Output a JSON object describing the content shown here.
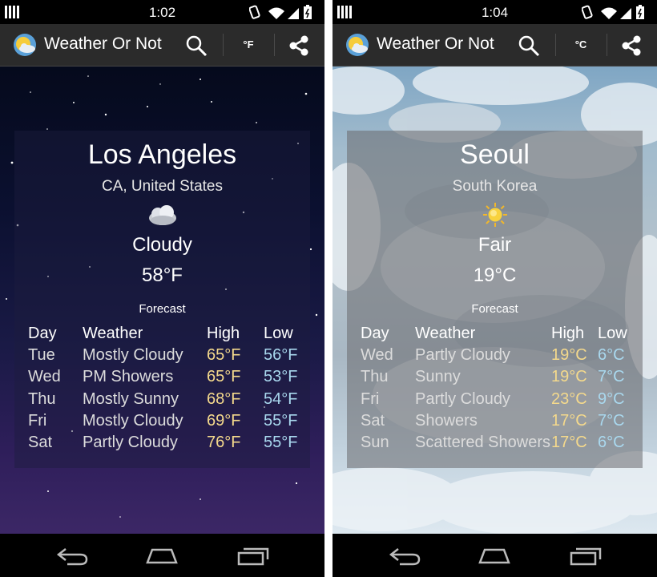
{
  "screens": [
    {
      "status": {
        "time": "1:02"
      },
      "app": {
        "title": "Weather Or Not",
        "unit_toggle": "°F"
      },
      "location": {
        "city": "Los Angeles",
        "region": "CA, United States"
      },
      "current": {
        "condition": "Cloudy",
        "temperature": "58°F",
        "icon": "cloudy-icon"
      },
      "forecast": {
        "title": "Forecast",
        "headers": {
          "day": "Day",
          "weather": "Weather",
          "high": "High",
          "low": "Low"
        },
        "rows": [
          {
            "day": "Tue",
            "weather": "Mostly Cloudy",
            "high": "65°F",
            "low": "56°F"
          },
          {
            "day": "Wed",
            "weather": "PM Showers",
            "high": "65°F",
            "low": "53°F"
          },
          {
            "day": "Thu",
            "weather": "Mostly Sunny",
            "high": "68°F",
            "low": "54°F"
          },
          {
            "day": "Fri",
            "weather": "Mostly Cloudy",
            "high": "69°F",
            "low": "55°F"
          },
          {
            "day": "Sat",
            "weather": "Partly Cloudy",
            "high": "76°F",
            "low": "55°F"
          }
        ]
      }
    },
    {
      "status": {
        "time": "1:04"
      },
      "app": {
        "title": "Weather Or Not",
        "unit_toggle": "°C"
      },
      "location": {
        "city": "Seoul",
        "region": "South Korea"
      },
      "current": {
        "condition": "Fair",
        "temperature": "19°C",
        "icon": "sun-icon"
      },
      "forecast": {
        "title": "Forecast",
        "headers": {
          "day": "Day",
          "weather": "Weather",
          "high": "High",
          "low": "Low"
        },
        "rows": [
          {
            "day": "Wed",
            "weather": "Partly Cloudy",
            "high": "19°C",
            "low": "6°C"
          },
          {
            "day": "Thu",
            "weather": "Sunny",
            "high": "19°C",
            "low": "7°C"
          },
          {
            "day": "Fri",
            "weather": "Partly Cloudy",
            "high": "23°C",
            "low": "9°C"
          },
          {
            "day": "Sat",
            "weather": "Showers",
            "high": "17°C",
            "low": "7°C"
          },
          {
            "day": "Sun",
            "weather": "Scattered Showers",
            "high": "17°C",
            "low": "6°C"
          }
        ]
      }
    }
  ],
  "colors": {
    "high_temp": "#f4d98c",
    "low_temp": "#a9d8ee",
    "action_bar": "#2b2b2b",
    "status_bar": "#000000"
  }
}
